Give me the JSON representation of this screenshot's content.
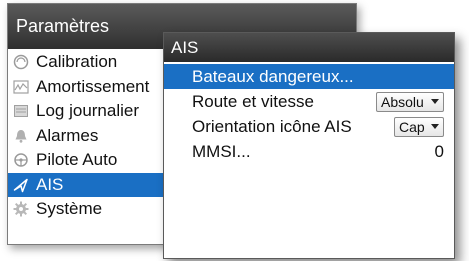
{
  "params": {
    "title": "Paramètres",
    "items": [
      {
        "label": "Calibration",
        "icon": "gauge-icon"
      },
      {
        "label": "Amortissement",
        "icon": "damping-icon"
      },
      {
        "label": "Log journalier",
        "icon": "log-icon"
      },
      {
        "label": "Alarmes",
        "icon": "bell-icon"
      },
      {
        "label": "Pilote Auto",
        "icon": "helm-icon"
      },
      {
        "label": "AIS",
        "icon": "ais-triangle-icon",
        "selected": true
      },
      {
        "label": "Système",
        "icon": "gear-icon"
      }
    ]
  },
  "ais": {
    "title": "AIS",
    "rows": {
      "dangerous": {
        "label": "Bateaux dangereux..."
      },
      "route": {
        "label": "Route et vitesse",
        "value": "Absolu"
      },
      "orientation": {
        "label": "Orientation icône AIS",
        "value": "Cap"
      },
      "mmsi": {
        "label": "MMSI...",
        "value": "0"
      }
    }
  },
  "colors": {
    "selection": "#1a6fc4",
    "title_bar": "#3a3a3a"
  }
}
